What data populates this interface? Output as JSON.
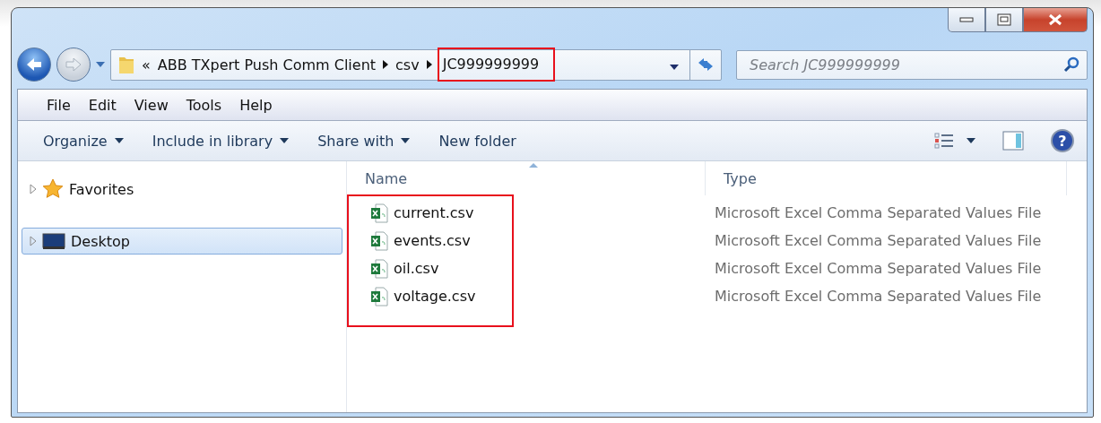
{
  "address": {
    "overflow": "«",
    "crumbs": [
      {
        "label": "ABB TXpert Push Comm Client",
        "highlighted": false
      },
      {
        "label": "csv",
        "highlighted": false
      },
      {
        "label": "JC999999999",
        "highlighted": true
      }
    ]
  },
  "search": {
    "placeholder": "Search JC999999999"
  },
  "help": "?",
  "menu": [
    "File",
    "Edit",
    "View",
    "Tools",
    "Help"
  ],
  "commands": [
    {
      "label": "Organize",
      "dropdown": true
    },
    {
      "label": "Include in library",
      "dropdown": true
    },
    {
      "label": "Share with",
      "dropdown": true
    },
    {
      "label": "New folder",
      "dropdown": false
    }
  ],
  "sidebar": {
    "items": [
      {
        "label": "Favorites",
        "kind": "star",
        "selected": false
      },
      {
        "label": "Desktop",
        "kind": "desktop",
        "selected": true
      }
    ]
  },
  "table": {
    "columns": [
      "Name",
      "Type"
    ],
    "highlighted": true,
    "rows": [
      {
        "name": "current.csv",
        "type": "Microsoft Excel Comma Separated Values File"
      },
      {
        "name": "events.csv",
        "type": "Microsoft Excel Comma Separated Values File"
      },
      {
        "name": "oil.csv",
        "type": "Microsoft Excel Comma Separated Values File"
      },
      {
        "name": "voltage.csv",
        "type": "Microsoft Excel Comma Separated Values File"
      }
    ]
  }
}
